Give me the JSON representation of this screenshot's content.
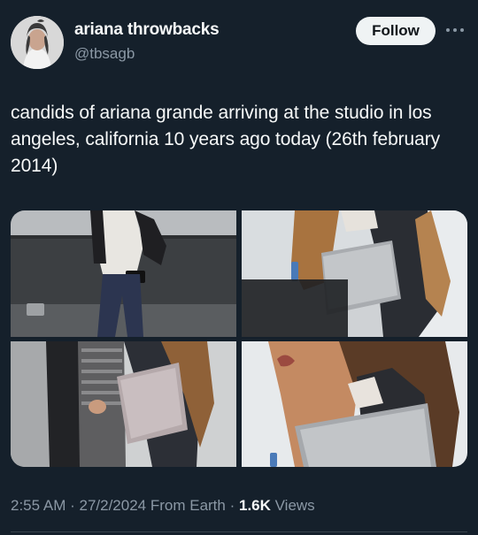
{
  "author": {
    "display_name": "ariana throwbacks",
    "handle": "@tbsagb",
    "avatar_icon": "profile-photo"
  },
  "actions": {
    "follow_label": "Follow",
    "more_icon": "more-dots-icon"
  },
  "tweet": {
    "text": "candids of ariana grande arriving at the studio in los angeles, california 10 years ago today (26th february 2014)"
  },
  "media": {
    "photo_count": 4
  },
  "meta": {
    "time": "2:55 AM",
    "sep1": " · ",
    "date": "27/2/2024",
    "source": " From Earth",
    "sep2": " · ",
    "views_count": "1.6K",
    "views_label": " Views"
  },
  "colors": {
    "background": "#15202b",
    "primary_text": "#f7f9f9",
    "secondary_text": "#8b98a5",
    "follow_bg": "#eff3f4"
  }
}
